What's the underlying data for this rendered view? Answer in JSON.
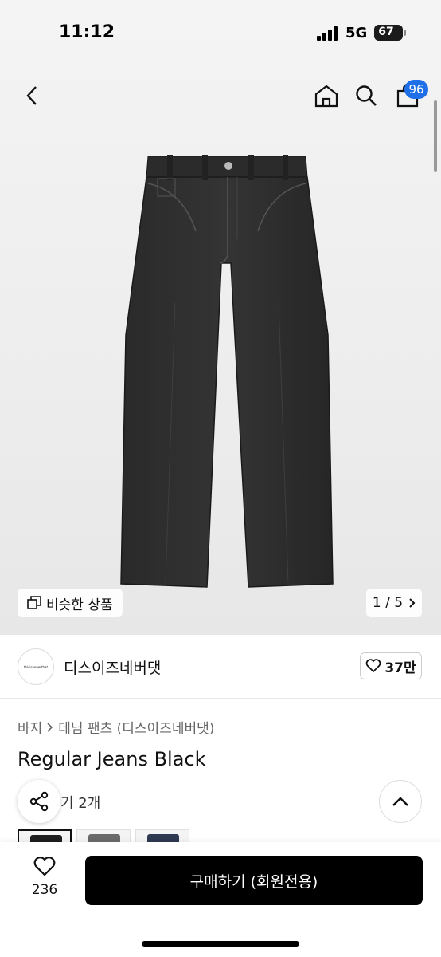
{
  "status_bar": {
    "time": "11:12",
    "network": "5G",
    "battery": "67",
    "battery_level": 0.67
  },
  "nav": {
    "cart_count": "96"
  },
  "gallery": {
    "similar_label": "비슷한 상품",
    "page_indicator": "1 / 5"
  },
  "brand": {
    "name": "디스이즈네버댓",
    "logo_text": "thisisneverthat",
    "like_count": "37만"
  },
  "breadcrumb": {
    "category": "바지",
    "subcategory": "데님 팬츠 (디스이즈네버댓)"
  },
  "product": {
    "title": "Regular Jeans Black",
    "colors_link": "기 2개"
  },
  "thumbnails": [
    {
      "label": "black",
      "color": "#1e1e1e"
    },
    {
      "label": "grey",
      "color": "#6a6a6a"
    },
    {
      "label": "indigo",
      "color": "#2e3a52"
    }
  ],
  "bottom_bar": {
    "wish_count": "236",
    "buy_label": "구매하기 (회원전용)"
  },
  "colors": {
    "cart_badge": "#1f6fe8",
    "buy_button": "#000000"
  }
}
